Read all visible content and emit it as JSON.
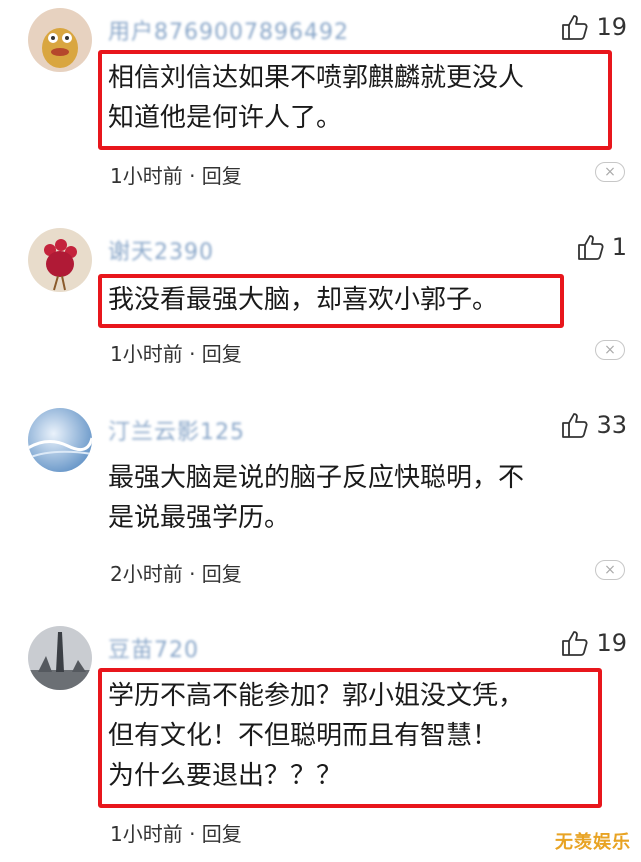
{
  "comments": [
    {
      "username": "用户8769007896492",
      "likes": "19",
      "lines": [
        "相信刘信达如果不喷郭麒麟就更没人",
        "知道他是何许人了。"
      ],
      "meta": "1小时前 · 回复"
    },
    {
      "username": "谢天2390",
      "likes": "1",
      "lines": [
        "我没看最强大脑，却喜欢小郭子。"
      ],
      "meta": "1小时前 · 回复"
    },
    {
      "username": "汀兰云影125",
      "likes": "33",
      "lines": [
        "最强大脑是说的脑子反应快聪明，不",
        "是说最强学历。"
      ],
      "meta": "2小时前 · 回复"
    },
    {
      "username": "豆苗720",
      "likes": "19",
      "lines": [
        "学历不高不能参加？郭小姐没文凭，",
        "但有文化！不但聪明而且有智慧！",
        "为什么要退出？？？"
      ],
      "meta": "1小时前 · 回复"
    }
  ],
  "close_symbol": "×",
  "watermark": "无羡娱乐",
  "colors": {
    "highlight": "#e8161c",
    "username": "#8aa7c9"
  },
  "icons": {
    "like": "thumbs-up-icon",
    "dismiss": "close-icon"
  }
}
